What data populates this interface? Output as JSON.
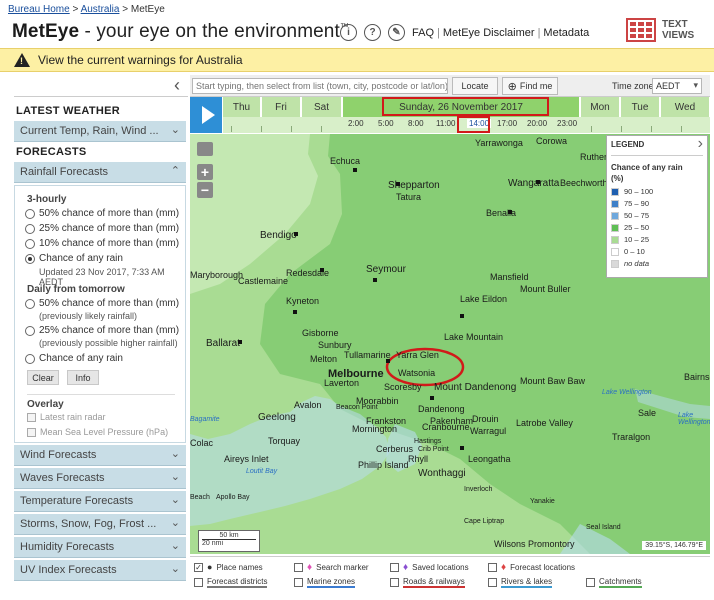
{
  "breadcrumb": {
    "home": "Bureau Home",
    "sep1": ">",
    "australia": "Australia",
    "sep2": ">",
    "current": "MetEye"
  },
  "header": {
    "brand": "MetEye",
    "tagline": " -  your eye on the environment",
    "tm": "™",
    "links": [
      "FAQ",
      "MetEye Disclaimer",
      "Metadata"
    ],
    "text_views_line1": "TEXT",
    "text_views_line2": "VIEWS",
    "icons": [
      "info-icon",
      "help-icon",
      "feedback-icon",
      "grid-icon"
    ]
  },
  "warning": {
    "text": "View the current warnings for Australia",
    "icon": "warning-icon"
  },
  "sidebar": {
    "latest_heading": "LATEST WEATHER",
    "current_temp": "Current Temp, Rain, Wind ...",
    "forecasts_heading": "FORECASTS",
    "rain_forecasts": "Rainfall Forecasts",
    "three_hourly": "3-hourly",
    "options_3h": [
      "50% chance of more than (mm)",
      "25% chance of more than (mm)",
      "10% chance of more than (mm)",
      "Chance of any rain"
    ],
    "updated": "Updated 23 Nov 2017, 7:33 AM AEDT",
    "daily_heading": "Daily from tomorrow",
    "opt_daily_50": "50% chance of more than (mm)",
    "note_50": "(previously likely rainfall)",
    "opt_daily_25": "25% chance of more than (mm)",
    "note_25": "(previously possible higher rainfall)",
    "opt_daily_any": "Chance of any rain",
    "clear": "Clear",
    "info": "Info",
    "overlay_heading": "Overlay",
    "overlay_radar": "Latest rain radar",
    "overlay_mslp": "Mean Sea Level Pressure (hPa)",
    "sections": [
      "Wind Forecasts",
      "Waves Forecasts",
      "Temperature Forecasts",
      "Storms, Snow, Fog, Frost ...",
      "Humidity Forecasts",
      "UV Index Forecasts"
    ]
  },
  "search": {
    "placeholder": "Start typing, then select from list (town, city, postcode or lat/lon)",
    "locate": "Locate",
    "find_me": "Find me",
    "tz_label": "Time zone",
    "tz_value": "AEDT"
  },
  "timeline": {
    "days": [
      "Thu",
      "Fri",
      "Sat",
      "Sunday, 26 November 2017",
      "Mon",
      "Tue",
      "Wed"
    ],
    "hours": [
      "2:00",
      "5:00",
      "8:00",
      "11:00",
      "14:00",
      "17:00",
      "20:00",
      "23:00"
    ],
    "selected_hour": "14:00"
  },
  "map": {
    "places": [
      "Yarrawonga",
      "Corowa",
      "Rutherglen",
      "Echuca",
      "Shepparton",
      "Tatura",
      "Wangaratta",
      "Beechworth",
      "Benalla",
      "Bendigo",
      "Seymour",
      "Mansfield",
      "Mount Buller",
      "Lake Eildon",
      "Castlemaine",
      "Redesdale",
      "Kyneton",
      "Gisborne",
      "Sunbury",
      "Lake Mountain",
      "Ballarat",
      "Melton",
      "Tullamarine",
      "Yarra Glen",
      "Watsonia",
      "Melbourne",
      "Laverton",
      "Scoresby",
      "Mount Dandenong",
      "Mount Baw Baw",
      "Bairnsdale",
      "Moorabbin",
      "Avalon",
      "Beacon Point",
      "Dandenong",
      "Frankston",
      "Geelong",
      "Mornington",
      "Pakenham",
      "Drouin",
      "Latrobe Valley",
      "Sale",
      "Cranbourne",
      "Warragul",
      "Traralgon",
      "Torquay",
      "Cerberus",
      "Hastings",
      "Crib Point",
      "Rhyll",
      "Aireys Inlet",
      "Phillip Island",
      "Leongatha",
      "Wonthaggi",
      "Inverloch",
      "Yanakie",
      "Cape Liptrap",
      "Seal Island",
      "Wilsons Promontory",
      "Apollo Bay",
      "Maryborough",
      "Colac",
      "Beach"
    ],
    "water": [
      "Lake Wellington",
      "Lake Wellington",
      "Bagamite",
      "Loutit Bay"
    ],
    "scale_km": "50 km",
    "scale_nmi": "20 nmi",
    "coords": "39.15°S, 146.79°E"
  },
  "legend": {
    "title": "LEGEND",
    "heading": "Chance of any rain",
    "unit": "(%)",
    "items": [
      {
        "label": "90 – 100",
        "color": "#1f5fb0"
      },
      {
        "label": "75 – 90",
        "color": "#3f80c8"
      },
      {
        "label": "50 – 75",
        "color": "#6fa8dc"
      },
      {
        "label": "25 – 50",
        "color": "#5fbf55"
      },
      {
        "label": "10 – 25",
        "color": "#a9dc93"
      },
      {
        "label": "0 – 10",
        "color": "#ffffff"
      },
      {
        "label": "no data",
        "color": "#d9d9d9"
      }
    ]
  },
  "footer": {
    "place_names": "Place names",
    "search_marker": "Search marker",
    "saved_locations": "Saved locations",
    "forecast_locations": "Forecast locations",
    "forecast_districts": "Forecast districts",
    "marine_zones": "Marine zones",
    "roads_railways": "Roads & railways",
    "rivers_lakes": "Rivers & lakes",
    "catchments": "Catchments"
  },
  "colors": {
    "accent_blue": "#2e8fd6",
    "highlight_red": "#d11a1a",
    "warning_yellow": "#fdf0a4"
  }
}
